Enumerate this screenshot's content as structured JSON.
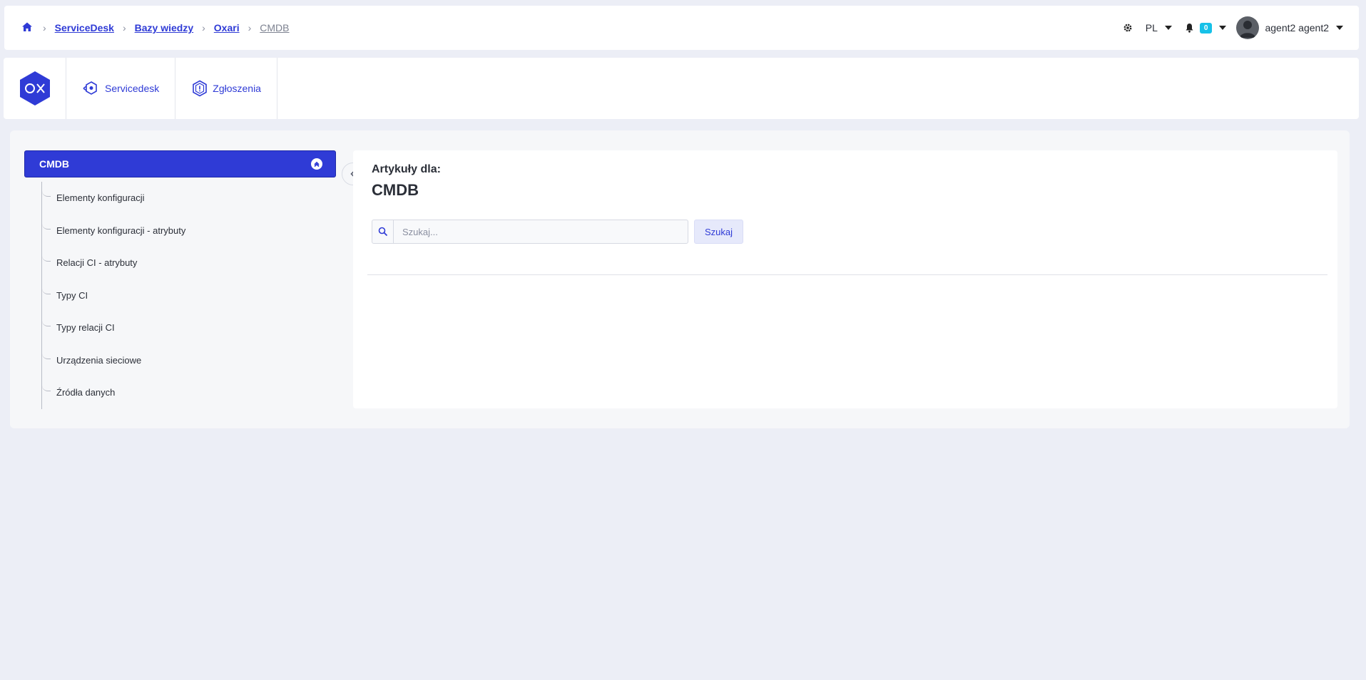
{
  "breadcrumb": {
    "home_icon": "home-icon",
    "items": [
      "ServiceDesk",
      "Bazy wiedzy",
      "Oxari"
    ],
    "current": "CMDB"
  },
  "topbar": {
    "language": "PL",
    "notifications_count": "0",
    "user_name": "agent2 agent2",
    "icons": [
      "settings-icon",
      "bell-icon",
      "avatar"
    ]
  },
  "navbar": {
    "logo": "oxari-logo",
    "items": [
      {
        "label": "Servicedesk",
        "icon": "servicedesk-icon"
      },
      {
        "label": "Zgłoszenia",
        "icon": "tickets-icon"
      }
    ]
  },
  "sidebar": {
    "header": "CMDB",
    "items": [
      "Elementy konfiguracji",
      "Elementy konfiguracji - atrybuty",
      "Relacji CI - atrybuty",
      "Typy CI",
      "Typy relacji CI",
      "Urządzenia sieciowe",
      "Źródła danych"
    ]
  },
  "content": {
    "subtitle": "Artykuły dla:",
    "title": "CMDB",
    "search": {
      "placeholder": "Szukaj...",
      "value": "",
      "button_label": "Szukaj"
    }
  },
  "colors": {
    "accent": "#2f3bd6",
    "badge": "#16c1e8",
    "background": "#eceef6"
  }
}
